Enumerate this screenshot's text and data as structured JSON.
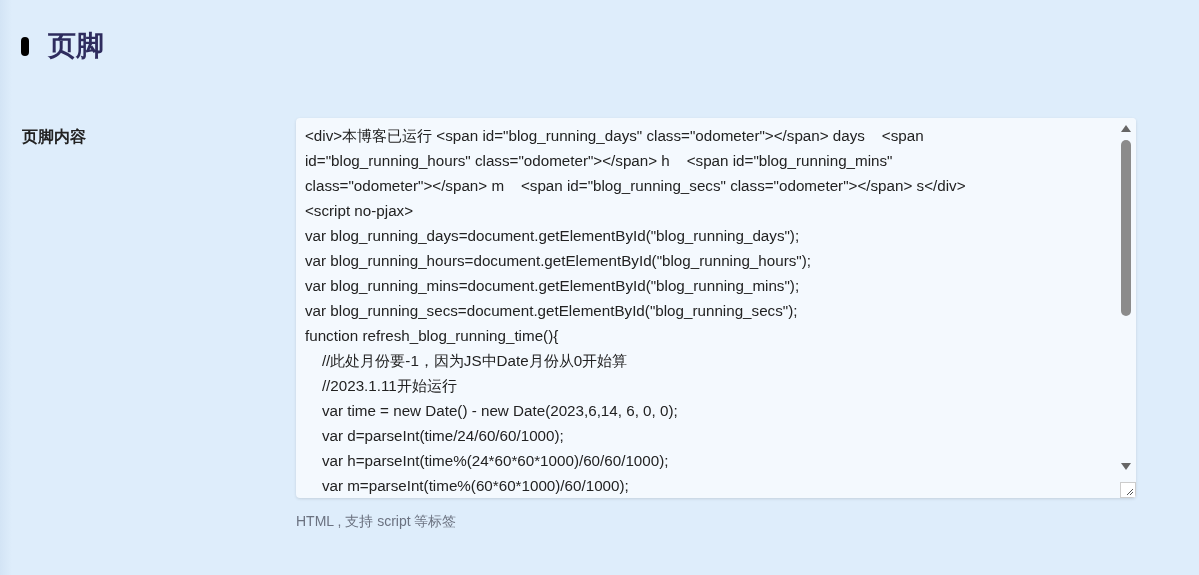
{
  "section": {
    "title": "页脚"
  },
  "field": {
    "label": "页脚内容",
    "lines": [
      "<div>本博客已运行 <span id=\"blog_running_days\" class=\"odometer\"></span> days    <span",
      "id=\"blog_running_hours\" class=\"odometer\"></span> h    <span id=\"blog_running_mins\"",
      "class=\"odometer\"></span> m    <span id=\"blog_running_secs\" class=\"odometer\"></span> s</div>",
      "<script no-pjax>",
      "var blog_running_days=document.getElementById(\"blog_running_days\");",
      "var blog_running_hours=document.getElementById(\"blog_running_hours\");",
      "var blog_running_mins=document.getElementById(\"blog_running_mins\");",
      "var blog_running_secs=document.getElementById(\"blog_running_secs\");",
      "function refresh_blog_running_time(){",
      "    //此处月份要-1，因为JS中Date月份从0开始算",
      "    //2023.1.11开始运行",
      "    var time = new Date() - new Date(2023,6,14, 6, 0, 0);",
      "    var d=parseInt(time/24/60/60/1000);",
      "    var h=parseInt(time%(24*60*60*1000)/60/60/1000);",
      "    var m=parseInt(time%(60*60*1000)/60/1000);"
    ],
    "hint": "HTML , 支持 script 等标签"
  }
}
